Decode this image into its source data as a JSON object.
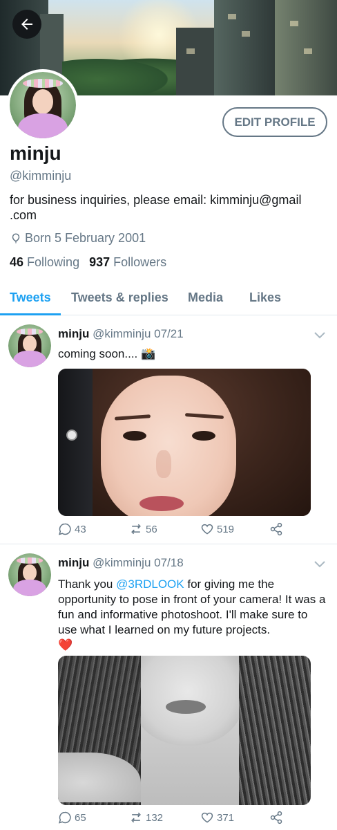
{
  "profile": {
    "display_name": "minju",
    "handle": "@kimminju",
    "bio": "for business inquiries, please email: kimminju@gmail\n.com",
    "born": "Born 5 February 2001",
    "following_count": "46",
    "following_label": "Following",
    "followers_count": "937",
    "followers_label": "Followers",
    "edit_profile_label": "EDIT PROFILE"
  },
  "tabs": [
    {
      "label": "Tweets",
      "active": true
    },
    {
      "label": "Tweets & replies",
      "active": false
    },
    {
      "label": "Media",
      "active": false
    },
    {
      "label": "Likes",
      "active": false
    }
  ],
  "tweets": [
    {
      "name": "minju",
      "handle": "@kimminju",
      "date": "07/21",
      "text": "coming soon.... 📸",
      "replies": "43",
      "retweets": "56",
      "likes": "519"
    },
    {
      "name": "minju",
      "handle": "@kimminju",
      "date": "07/18",
      "text_before": "Thank you ",
      "mention": "@3RDLOOK",
      "text_after": " for giving me the opportunity to pose in front of your camera! It was a fun and informative photoshoot. I'll make sure to use what I learned on my future projects.",
      "emoji": "❤️",
      "replies": "65",
      "retweets": "132",
      "likes": "371"
    }
  ],
  "colors": {
    "accent": "#1da1f2",
    "text_primary": "#14171a",
    "text_secondary": "#657786",
    "divider": "#e1e8ed"
  },
  "icons": [
    "back-arrow-icon",
    "location-icon",
    "chevron-down-icon",
    "reply-icon",
    "retweet-icon",
    "like-icon",
    "share-icon"
  ]
}
